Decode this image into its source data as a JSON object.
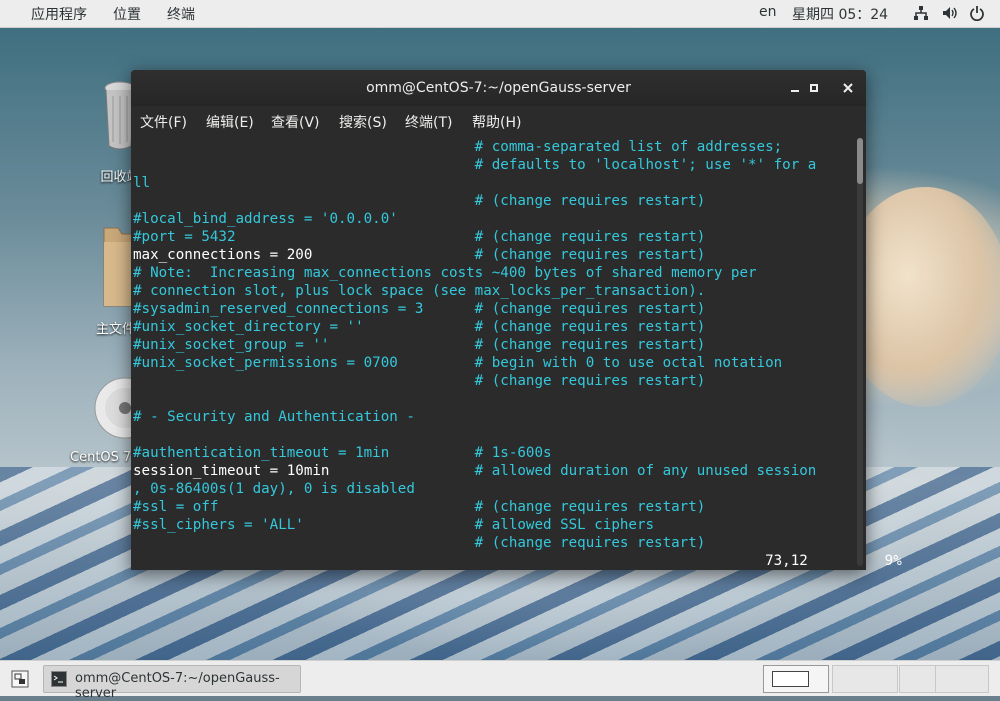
{
  "topbar": {
    "applications": "应用程序",
    "places": "位置",
    "terminal": "终端",
    "lang": "en",
    "clock": "星期四 05：24"
  },
  "desktop": {
    "trash_label": "回收站",
    "home_label": "主文件夹",
    "disc_label": "CentOS 7 x86_64"
  },
  "window": {
    "title": "omm@CentOS-7:~/openGauss-server",
    "menu": [
      "文件(F)",
      "编辑(E)",
      "查看(V)",
      "搜索(S)",
      "终端(T)",
      "帮助(H)"
    ]
  },
  "terminal": {
    "lines": [
      {
        "a": "",
        "b": "                                        # comma-separated list of addresses;"
      },
      {
        "a": "",
        "b": "                                        # defaults to 'localhost'; use '*' for a"
      },
      {
        "a": "",
        "b": "ll"
      },
      {
        "a": "",
        "b": "                                        # (change requires restart)"
      },
      {
        "a": "",
        "b": "#local_bind_address = '0.0.0.0'"
      },
      {
        "a": "",
        "b": "#port = 5432                            # (change requires restart)"
      },
      {
        "a": "max_connections = 200",
        "b": "                   # (change requires restart)"
      },
      {
        "a": "",
        "b": "# Note:  Increasing max_connections costs ~400 bytes of shared memory per"
      },
      {
        "a": "",
        "b": "# connection slot, plus lock space (see max_locks_per_transaction)."
      },
      {
        "a": "",
        "b": "#sysadmin_reserved_connections = 3      # (change requires restart)"
      },
      {
        "a": "",
        "b": "#unix_socket_directory = ''             # (change requires restart)"
      },
      {
        "a": "",
        "b": "#unix_socket_group = ''                 # (change requires restart)"
      },
      {
        "a": "",
        "b": "#unix_socket_permissions = 0700         # begin with 0 to use octal notation"
      },
      {
        "a": "",
        "b": "                                        # (change requires restart)"
      },
      {
        "a": "",
        "b": ""
      },
      {
        "a": "",
        "b": "# - Security and Authentication -"
      },
      {
        "a": "",
        "b": ""
      },
      {
        "a": "",
        "b": "#authentication_timeout = 1min          # 1s-600s"
      },
      {
        "a": "session_timeout = 10min",
        "b": "                 # allowed duration of any unused session"
      },
      {
        "a": "",
        "b": ", 0s-86400s(1 day), 0 is disabled"
      },
      {
        "a": "",
        "b": "#ssl = off                              # (change requires restart)"
      },
      {
        "a": "",
        "b": "#ssl_ciphers = 'ALL'                    # allowed SSL ciphers"
      },
      {
        "a": "",
        "b": "                                        # (change requires restart)"
      },
      {
        "a": "                                                                          73,12         9%",
        "b": ""
      }
    ]
  },
  "taskbar": {
    "task_label": "omm@CentOS-7:~/openGauss-server"
  },
  "colors": {
    "terminal_bg": "#2b2b2b",
    "comment_cyan": "#34c8dc",
    "text_white": "#ffffff"
  }
}
